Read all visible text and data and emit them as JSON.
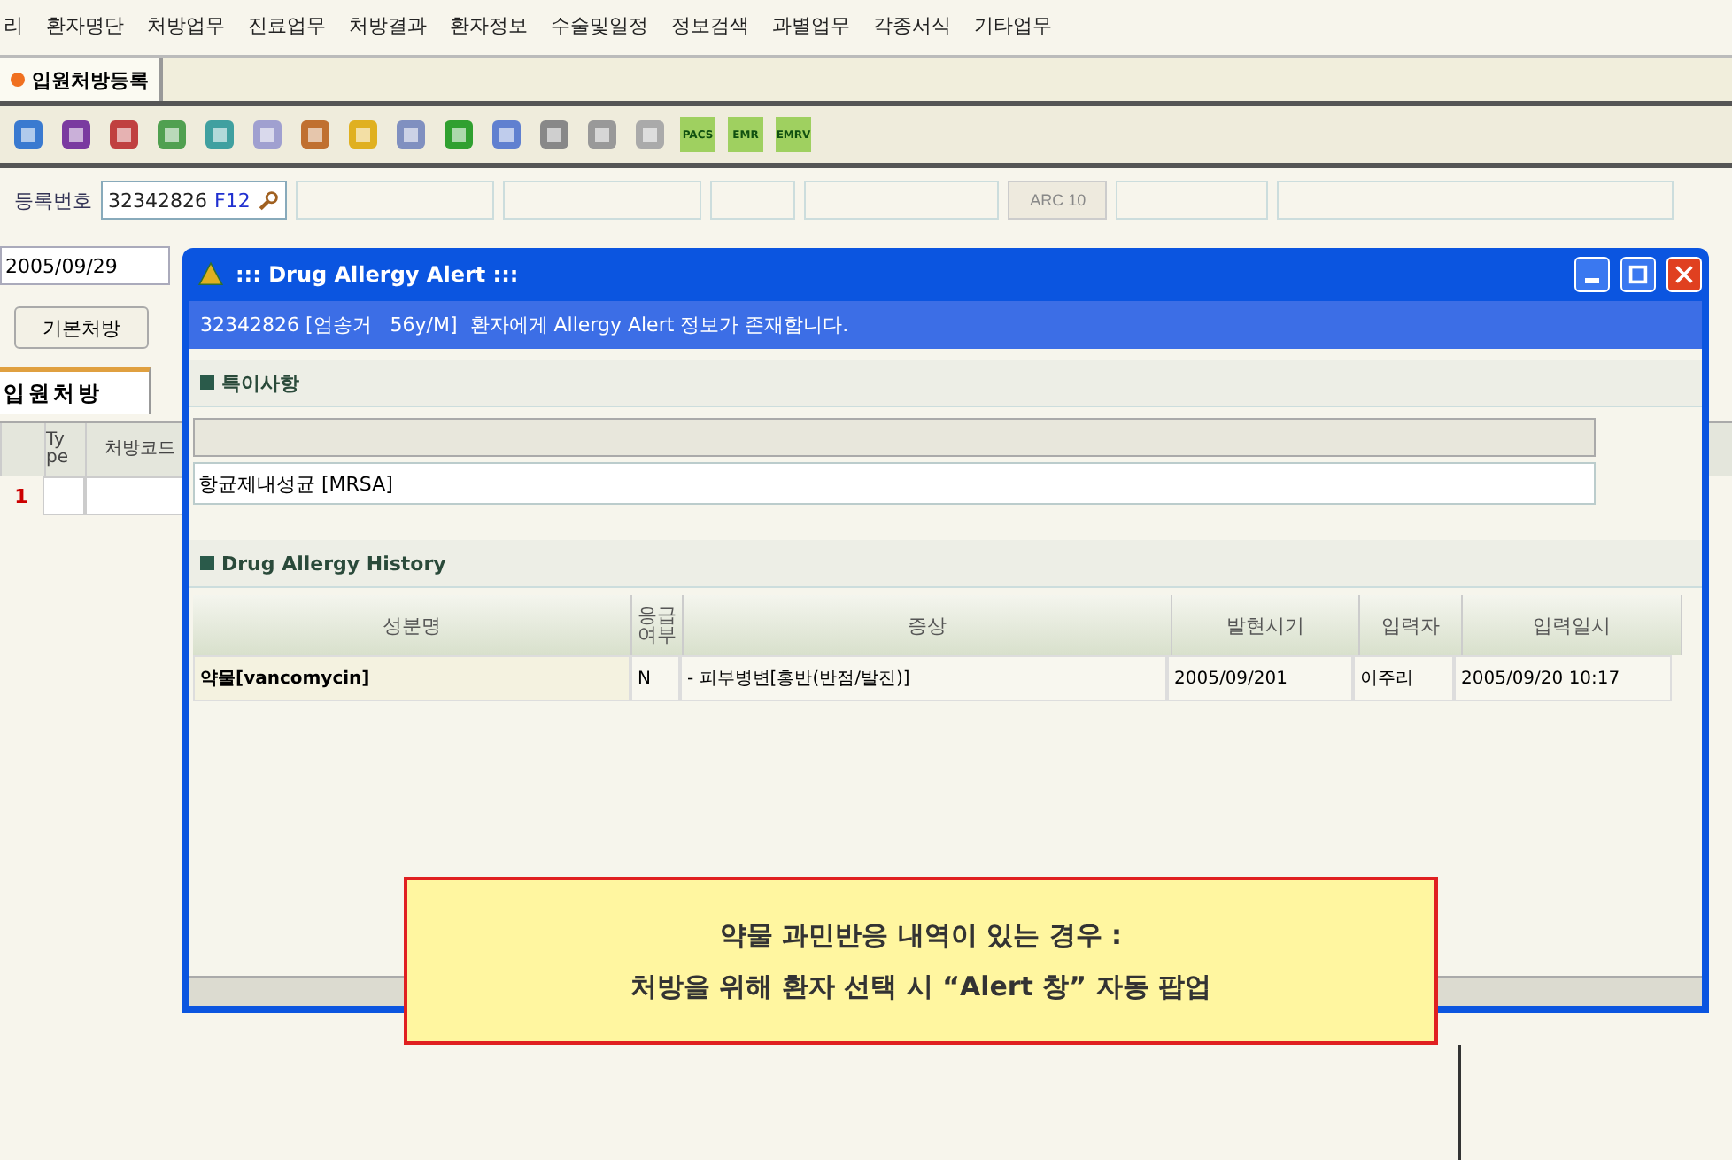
{
  "menu_bar": [
    "리",
    "환자명단",
    "처방업무",
    "진료업무",
    "처방결과",
    "환자정보",
    "수술및일정",
    "정보검색",
    "과별업무",
    "각종서식",
    "기타업무"
  ],
  "doc_tabs": [
    {
      "label": "입원처방등록",
      "selected": true
    }
  ],
  "toolbar": [
    {
      "kind": "icon"
    },
    {
      "kind": "icon"
    },
    {
      "kind": "icon"
    },
    {
      "kind": "icon"
    },
    {
      "kind": "icon"
    },
    {
      "kind": "icon"
    },
    {
      "kind": "icon"
    },
    {
      "kind": "icon"
    },
    {
      "kind": "icon"
    },
    {
      "kind": "icon"
    },
    {
      "kind": "icon"
    },
    {
      "kind": "icon"
    },
    {
      "kind": "icon"
    },
    {
      "kind": "icon"
    },
    {
      "kind": "labeled",
      "label": "PACS"
    },
    {
      "kind": "labeled",
      "label": "EMR"
    },
    {
      "kind": "labeled",
      "label": "EMRV"
    }
  ],
  "registration": {
    "label": "등록번호",
    "value": "32342826",
    "shortcut": "F12",
    "arc_button": "ARC 10"
  },
  "date_select": {
    "value": "2005/09/29"
  },
  "basic_button": "기본처방",
  "order_tabs": [
    {
      "label": "입원처방",
      "selected": true
    }
  ],
  "order_grid": {
    "columns": [
      "Ty pe",
      "처방코드"
    ],
    "rows": [
      {
        "number": "1"
      }
    ]
  },
  "dialog": {
    "title": "::: Drug Allergy Alert :::",
    "banner": "32342826 [엄송거   56y/M]  환자에게 Allergy Alert 정보가 존재합니다.",
    "notes_section": "특이사항",
    "notes_value": "항균제내성균 [MRSA]",
    "history_section": "Drug Allergy History",
    "columns": [
      "성분명",
      "응급 여부",
      "증상",
      "발현시기",
      "입력자",
      "입력일시"
    ],
    "rows": [
      [
        "약물[vancomycin]",
        "N",
        "- 피부병변[홍반(반점/발진)]",
        "2005/09/201",
        "이주리",
        "2005/09/20 10:17"
      ]
    ]
  },
  "callout": [
    "약물 과민반응 내역이 있는 경우 :",
    "처방을 위해 환자 선택 시 “Alert 창” 자동 팝업"
  ]
}
